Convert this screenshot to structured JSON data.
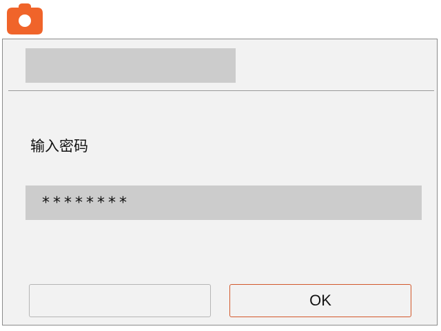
{
  "app": {
    "icon": "camera-icon",
    "accent_color": "#f0642a"
  },
  "dialog": {
    "title": "",
    "prompt": "输入密码",
    "password_value": "********",
    "buttons": {
      "cancel_label": "",
      "ok_label": "OK"
    }
  }
}
